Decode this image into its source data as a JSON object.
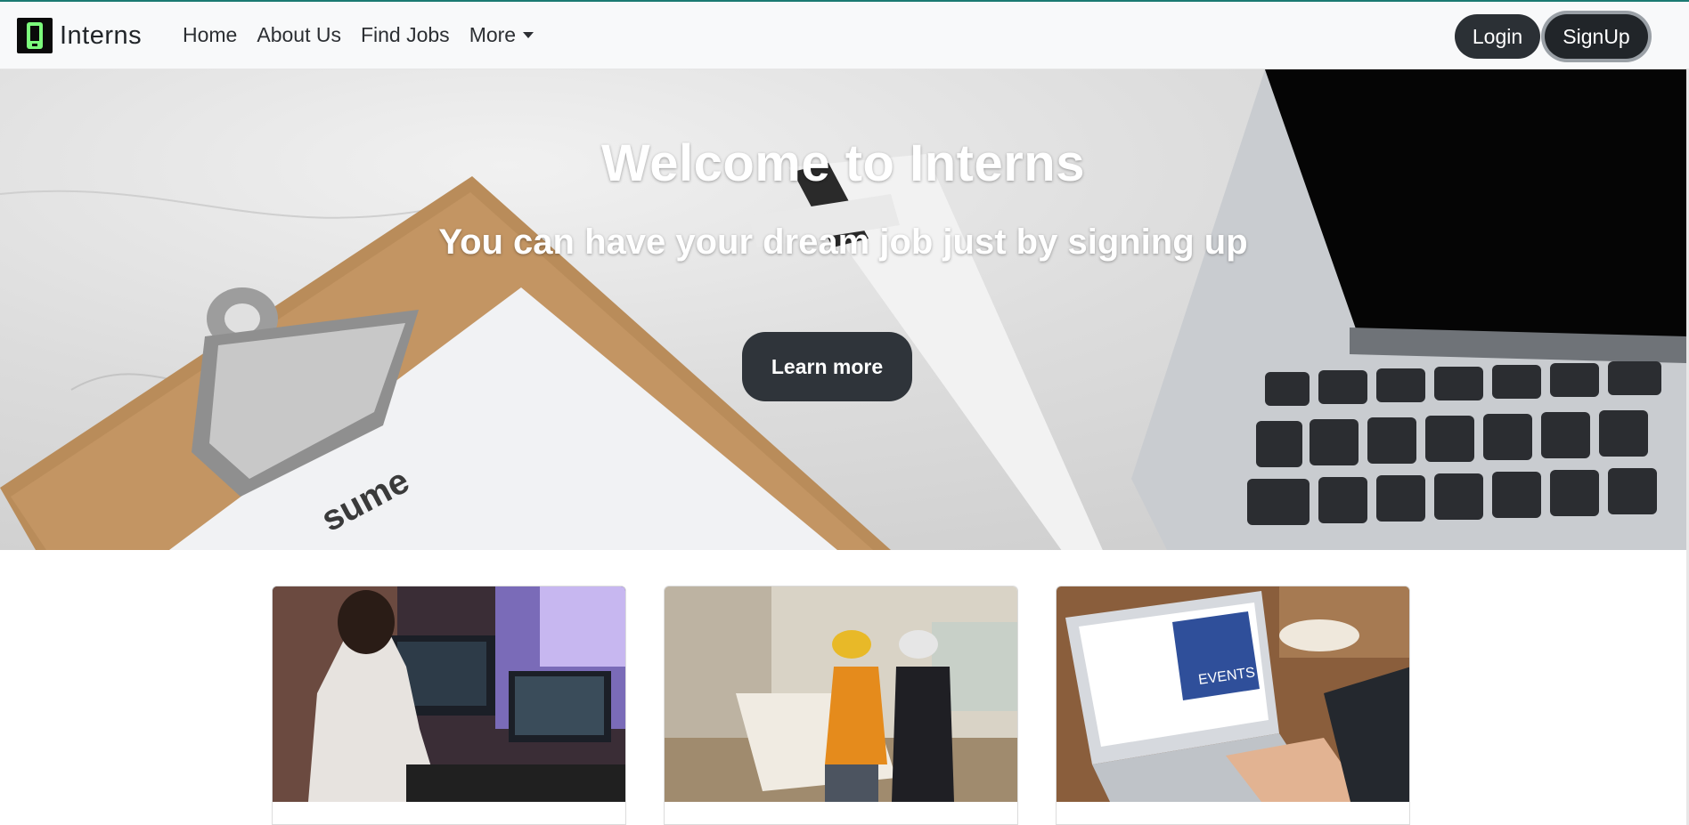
{
  "brand": {
    "name": "Interns",
    "logo_icon": "phone-logo-icon",
    "logo_color": "#7CFC7C"
  },
  "nav": {
    "links": [
      "Home",
      "About Us",
      "Find Jobs"
    ],
    "more_label": "More"
  },
  "auth": {
    "login_label": "Login",
    "signup_label": "SignUp"
  },
  "hero": {
    "title": "Welcome to Interns",
    "subtitle": "You can have your dream job just by signing up",
    "cta_label": "Learn more",
    "clipboard_text": "sume"
  },
  "cards": [
    {
      "image": "person-at-computer-photo"
    },
    {
      "image": "engineers-with-blueprint-photo"
    },
    {
      "image": "events-laptop-photo",
      "image_text": "EVENTS"
    }
  ],
  "colors": {
    "accent_line": "#1b7a72",
    "button_dark": "#212529"
  }
}
